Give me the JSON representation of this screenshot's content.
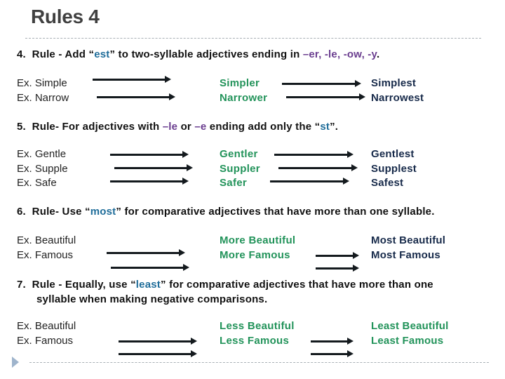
{
  "slide": {
    "title": "Rules 4"
  },
  "colors": {
    "title": "#404040",
    "keyword_blue": "#1f6d9a",
    "suffix_purple": "#6a3d8f",
    "comparative_green": "#22935a",
    "superlative_navy": "#172a4a",
    "arrow": "#141a1e",
    "divider": "#a9b0b6",
    "bullet": "#9fb4cc"
  },
  "rules": [
    {
      "number": "4.",
      "text_before": "Rule - Add “",
      "keyword": "est",
      "text_mid": "” to two-syllable adjectives ending in ",
      "suffixes": "–er, -le, -ow, -y",
      "text_after": ".",
      "examples": [
        {
          "base": "Ex. Simple",
          "comparative": "Simpler",
          "superlative": "Simplest"
        },
        {
          "base": "Ex.  Narrow",
          "comparative": "Narrower",
          "superlative": "Narrowest"
        }
      ]
    },
    {
      "number": "5.",
      "text_before": "Rule- For adjectives with ",
      "suffix1": "–le",
      "text_or": " or ",
      "suffix2": "–e",
      "text_mid": " ending add only the “",
      "keyword": "st",
      "text_after": "”.",
      "examples": [
        {
          "base": "Ex.  Gentle",
          "comparative": "Gentler",
          "superlative": "Gentlest"
        },
        {
          "base": "Ex.  Supple",
          "comparative": "Suppler",
          "superlative": "Supplest"
        },
        {
          "base": "Ex.  Safe",
          "comparative": "Safer",
          "superlative": "Safest"
        }
      ]
    },
    {
      "number": "6.",
      "text_before": "Rule- Use “",
      "keyword": "most",
      "text_after": "” for comparative adjectives that have more than one syllable.",
      "examples": [
        {
          "base": "Ex.  Beautiful",
          "comparative": "More Beautiful",
          "superlative": "Most Beautiful"
        },
        {
          "base": "Ex.  Famous",
          "comparative": "More Famous",
          "superlative": "Most Famous"
        }
      ]
    },
    {
      "number": "7.",
      "text_before": "Rule - Equally, use “",
      "keyword": "least",
      "text_after": "” for comparative adjectives that have more than one",
      "text_line2": "syllable when making negative comparisons.",
      "examples": [
        {
          "base": "Ex.  Beautiful",
          "comparative": "Less Beautiful",
          "superlative": "Least Beautiful"
        },
        {
          "base": "Ex.  Famous",
          "comparative": "Less Famous",
          "superlative": "Least Famous"
        }
      ]
    }
  ],
  "icons": {
    "bullet": "triangle-bullet-icon",
    "arrow": "right-arrow-icon"
  }
}
